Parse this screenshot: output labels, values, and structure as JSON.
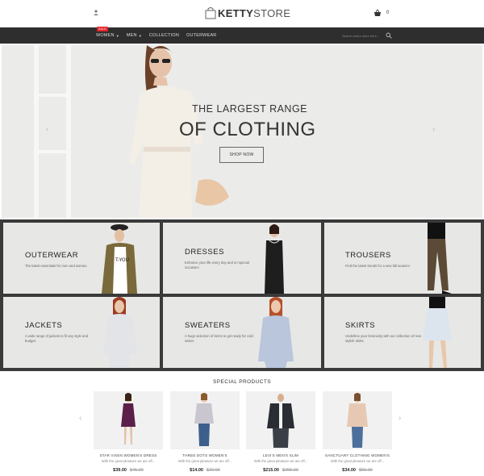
{
  "header": {
    "logo_bold": "KETTY",
    "logo_light": "STORE",
    "cart_count": "0"
  },
  "nav": {
    "items": [
      {
        "label": "WOMEN",
        "has_caret": true,
        "badge": "SALE"
      },
      {
        "label": "MEN",
        "has_caret": true
      },
      {
        "label": "COLLECTION"
      },
      {
        "label": "OUTERWEAR"
      }
    ],
    "search_placeholder": "Search entire store here..."
  },
  "hero": {
    "title_line1": "THE LARGEST RANGE",
    "title_line2": "OF CLOTHING",
    "button": "SHOP NOW"
  },
  "categories": [
    {
      "title": "OUTERWEAR",
      "desc": "The latest essentials for men and women."
    },
    {
      "title": "DRESSES",
      "desc": "Enhance your life every day and on special occasion!"
    },
    {
      "title": "TROUSERS",
      "desc": "Find the latest trends for a new fall season!"
    },
    {
      "title": "JACKETS",
      "desc": "A wide range of jackets to fit any style and budget."
    },
    {
      "title": "SWEATERS",
      "desc": "A huge selection of items to get ready for cold winter."
    },
    {
      "title": "SKIRTS",
      "desc": "Underline your femininity with our collection of new stylish skirts."
    }
  ],
  "special": {
    "title": "SPECIAL PRODUCTS",
    "products": [
      {
        "name": "STAR VIXEN WOMEN'S DRESS",
        "desc": "With the great pleasure we are off...",
        "price": "$39.00",
        "old_price": "$45.00"
      },
      {
        "name": "THREE DOTS WOMEN'S",
        "desc": "With the great pleasure we are off...",
        "price": "$14.00",
        "old_price": "$20.00"
      },
      {
        "name": "LEVI'S MEN'S SLIM",
        "desc": "With the great pleasure we are off...",
        "price": "$215.00",
        "old_price": "$255.00"
      },
      {
        "name": "SANCTUARY CLOTHING WOMEN'S",
        "desc": "With the great pleasure we are off...",
        "price": "$34.00",
        "old_price": "$55.00"
      }
    ]
  },
  "colors": {
    "nav_bg": "#2e2e2e",
    "sale_badge": "#e0262b",
    "hero_bg": "#ebebe9",
    "category_bg": "#e7e7e5"
  }
}
